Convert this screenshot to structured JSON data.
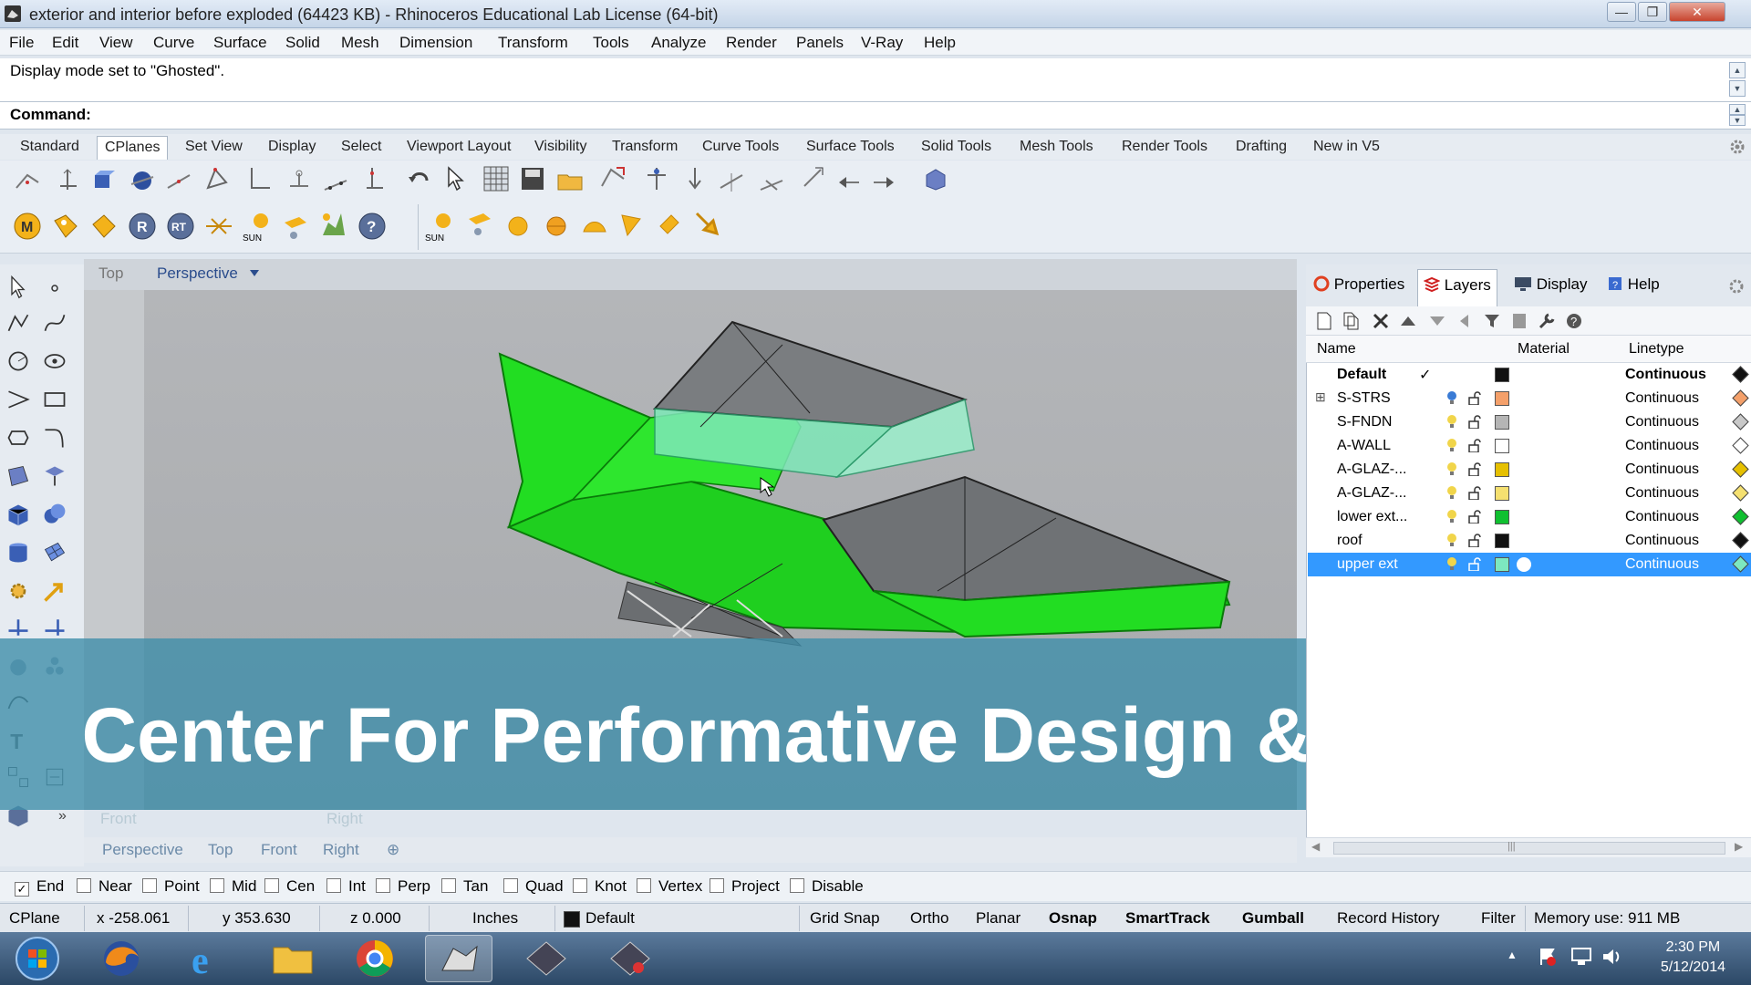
{
  "window": {
    "title": "exterior and interior before exploded (64423 KB) - Rhinoceros Educational Lab License (64-bit)",
    "minimize": "—",
    "restore": "❐",
    "close": "✕"
  },
  "menu": [
    "File",
    "Edit",
    "View",
    "Curve",
    "Surface",
    "Solid",
    "Mesh",
    "Dimension",
    "Transform",
    "Tools",
    "Analyze",
    "Render",
    "Panels",
    "V-Ray",
    "Help"
  ],
  "history": {
    "text": "Display mode set to \"Ghosted\"."
  },
  "command": {
    "label": "Command:"
  },
  "toolbar_tabs": [
    "Standard",
    "CPlanes",
    "Set View",
    "Display",
    "Select",
    "Viewport Layout",
    "Visibility",
    "Transform",
    "Curve Tools",
    "Surface Tools",
    "Solid Tools",
    "Mesh Tools",
    "Render Tools",
    "Drafting",
    "New in V5"
  ],
  "toolbar_tabs_active": "CPlanes",
  "vray_labels": {
    "sun1": "SUN",
    "sun2": "SUN"
  },
  "viewport": {
    "top_tab": "Top",
    "active_title": "Perspective",
    "bottom_tabs": [
      "Perspective",
      "Top",
      "Front",
      "Right"
    ],
    "ghost_labels": [
      "Front",
      "Right"
    ]
  },
  "banner": {
    "text": "Center For Performative Design & Fuse Lab"
  },
  "panel": {
    "tabs": [
      "Properties",
      "Layers",
      "Display",
      "Help"
    ],
    "active_tab": "Layers",
    "headers": {
      "name": "Name",
      "material": "Material",
      "linetype": "Linetype"
    },
    "layers": [
      {
        "name": "Default",
        "current": "✓",
        "color": "#111111",
        "linetype": "Continuous",
        "bold": true,
        "diamond": "#111111"
      },
      {
        "name": "S-STRS",
        "color": "#f4a06a",
        "linetype": "Continuous",
        "expand": "⊞",
        "diamond": "#f4a06a",
        "bulb": "#3a7bd5"
      },
      {
        "name": "S-FNDN",
        "color": "#b5b5b5",
        "linetype": "Continuous",
        "diamond": "#c9c9c9",
        "bulb": "#f1d54a"
      },
      {
        "name": "A-WALL",
        "color": "#ffffff",
        "linetype": "Continuous",
        "diamond": "#ffffff",
        "bulb": "#f1d54a"
      },
      {
        "name": "A-GLAZ-...",
        "color": "#e6c000",
        "linetype": "Continuous",
        "diamond": "#e6c000",
        "bulb": "#f1d54a"
      },
      {
        "name": "A-GLAZ-...",
        "color": "#f5e070",
        "linetype": "Continuous",
        "diamond": "#f5e070",
        "bulb": "#f1d54a"
      },
      {
        "name": "lower ext...",
        "color": "#10c030",
        "linetype": "Continuous",
        "diamond": "#10c030",
        "bulb": "#f1d54a"
      },
      {
        "name": "roof",
        "color": "#111111",
        "linetype": "Continuous",
        "diamond": "#111111",
        "bulb": "#f1d54a"
      },
      {
        "name": "upper ext",
        "color": "#7de8c0",
        "linetype": "Continuous",
        "selected": true,
        "diamond": "#7de8c0",
        "bulb": "#f1d54a"
      }
    ],
    "scroll_grip": "|||"
  },
  "osnaps": [
    {
      "label": "End",
      "checked": true
    },
    {
      "label": "Near",
      "checked": false
    },
    {
      "label": "Point",
      "checked": false
    },
    {
      "label": "Mid",
      "checked": false
    },
    {
      "label": "Cen",
      "checked": false
    },
    {
      "label": "Int",
      "checked": false
    },
    {
      "label": "Perp",
      "checked": false
    },
    {
      "label": "Tan",
      "checked": false
    },
    {
      "label": "Quad",
      "checked": false
    },
    {
      "label": "Knot",
      "checked": false
    },
    {
      "label": "Vertex",
      "checked": false
    },
    {
      "label": "Project",
      "checked": false
    },
    {
      "label": "Disable",
      "checked": false
    }
  ],
  "status": {
    "cplane": "CPlane",
    "x": "x -258.061",
    "y": "y 353.630",
    "z": "z 0.000",
    "units": "Inches",
    "layer": "Default",
    "grid_snap": "Grid Snap",
    "ortho": "Ortho",
    "planar": "Planar",
    "osnap": "Osnap",
    "smarttrack": "SmartTrack",
    "gumball": "Gumball",
    "record_history": "Record History",
    "filter": "Filter",
    "memory": "Memory use: 911 MB"
  },
  "taskbar": {
    "time": "2:30 PM",
    "date": "5/12/2014"
  },
  "colors": {
    "accent": "#3399ff",
    "model_green": "#22dd22",
    "banner": "#408eaa"
  }
}
